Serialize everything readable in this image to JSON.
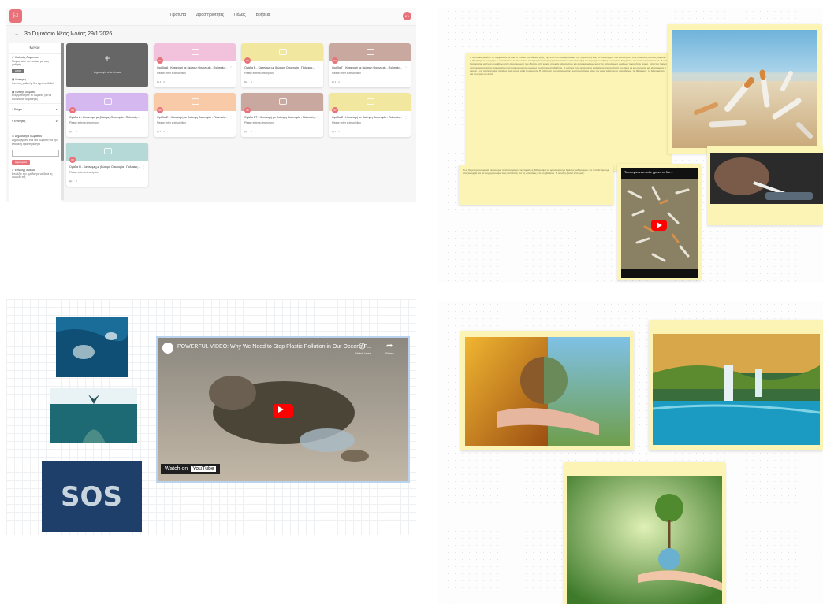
{
  "app": {
    "logo_glyph": "⚐",
    "nav": [
      "Πρότυπα",
      "Δραστηριότητες",
      "Πόλεις",
      "Βοήθεια"
    ],
    "user_initials": "ΚΑ",
    "back_glyph": "←",
    "page_title": "3ο Γυμνάσιο Νέας Ιωνίας 29/1/2026",
    "sidebar": {
      "title": "Μενού",
      "sec1_head": "✔ Κωδικός δωματίου",
      "sec1_text": "Μοιραστείτε τον κωδικό με τους μαθητές",
      "room_code": "ARN8",
      "sec2_head": "▤ Μαθητές",
      "sec2_text": "Κανένας μαθητής δεν έχει συνδεθεί",
      "sec3_head": "▤ Ενεργή δωμάτια",
      "sec3_text": "Ενεργοποιήστε το δωμάτιο για να συνδεθούν οι μαθητές",
      "row1": "≡ Στόχοι",
      "row2": "≡ Ενότητες",
      "chevron": "∨",
      "sec4_head": "☐ Δημιουργία δωματίου",
      "sec4_text": "Δημιουργήστε ένα νέο δωμάτιο για την επόμενη δραστηριότητα",
      "create_btn": "Δημιουργία",
      "sec5_head": "✔ Επιλογή ομάδας",
      "sec5_text": "Επιλέξτε την ομάδα για να δείτε τη δουλειά της"
    },
    "add_card_label": "Δημιουργία νέου πίνακα",
    "add_glyph": "+",
    "cards": [
      {
        "num": "01",
        "title": "Ομάδα Α - Κατανομή με βιώσιμη Οικονομία - Πολιτικές...",
        "desc": "Please enter a description",
        "foot": "▤ 4 · 4",
        "color": "#f2c2dd"
      },
      {
        "num": "02",
        "title": "Ομάδα Β - Κατανομή με βιώσιμη Οικονομία - Πολιτικές...",
        "desc": "Please enter a description",
        "foot": "▤ 4 · 4",
        "color": "#f2e79e"
      },
      {
        "num": "03",
        "title": "Ομάδα Γ - Κατανομή με βιώσιμη Οικονομία - Πολιτικές...",
        "desc": "Please enter a description",
        "foot": "▤ 4 · 4",
        "color": "#c9a99f"
      },
      {
        "num": "04",
        "title": "Ομάδα Δ - Κατανομή με βιώσιμη Οικονομία - Πολιτικές...",
        "desc": "Please enter a description",
        "foot": "▤ 4 · 4",
        "color": "#d6b8f0"
      },
      {
        "num": "05",
        "title": "Ομάδα Ε - Κατανομή με βιώσιμη Οικονομία - Πολιτικές...",
        "desc": "Please enter a description",
        "foot": "▤ 3 · 4",
        "color": "#f9caa8"
      },
      {
        "num": "06",
        "title": "Ομάδα ΣΤ - Κατανομή με βιώσιμη Οικονομία - Πολιτικές...",
        "desc": "Please enter a description",
        "foot": "▤ 4 · 4",
        "color": "#c9a99f"
      },
      {
        "num": "07",
        "title": "Ομάδα Ζ - Κατανομή με βιώσιμη Οικονομία - Πολιτικές...",
        "desc": "Please enter a description",
        "foot": "▤ 1 · 4",
        "color": "#f2e79e"
      },
      {
        "num": "08",
        "title": "Ομάδα Η - Κατανομή με βιώσιμη Οικονομία - Πολιτικές...",
        "desc": "Please enter a description",
        "foot": "▤ 3 · 4",
        "color": "#b5d9d6"
      }
    ],
    "colors": {
      "accent": "#e8727a",
      "add_card": "#666666",
      "note": "#fbf4b4"
    }
  },
  "board_smoking": {
    "note_text": "Η ταμπακιά μολύνει το περιβάλλον σε όλα τα στάδια του κύκλου ζωής της, από την καλλιέργεια και την παραγωγή έως τα αποτσίγαρα που καταλήγουν στις θάλασσες και στις παραλίες. Τα φίλτρα των τσιγάρων αποτελούν ένα από τα πιο συνηθισμένα απορρίμματα πλαστικού στον πλανήτη και περιέχουν τοξικές ουσίες που διαρρέουν στο έδαφος και στο νερό. Η καλλιέργεια του καπνού συμβάλλει στην απογύμνωση των δασών, στη χρήση χημικών λιπασμάτων και φυτοφαρμάκων και στην κατανάλωση μεγάλων ποσοτήτων νερού. Κατά την παραγωγή εκλύονται αέρια θερμοκηπίου και δημιουργούνται μεγάλες ποσότητες αποβλήτων. Ο καπνός που εκπέμπεται επιβαρύνει την ποιότητα του αέρα σε εσωτερικούς και εξωτερικούς χώρους, ενώ τα πεταγμένα τσιγάρα είναι συχνή αιτία πυρκαγιών. Η ελάττωση του καπνίσματος δεν προστατεύει μόνο την υγεία αλλά και το περιβάλλον, τις θάλασσες, τα δάση και τα ζώα που ζουν σε αυτά.",
    "note2_text": "Πώς θα μπορούσαμε να μειώσουμε τα αποτσίγαρα στις παραλίες; Μπορούμε να οργανώσουμε δράσεις καθαρισμού, να τοποθετήσουμε σταχτοδοχεία και να ενημερώσουμε τους καπνιστές για τις συνέπειες στο περιβάλλον. Η αλλαγή ξεκινά από εμάς.",
    "video_title": "Τι απογίνονται καθε χρόνο τα δισ..."
  },
  "board_plastic": {
    "video_title": "POWERFUL VIDEO: Why We Need to Stop Plastic Pollution in Our Oceans F...",
    "watch_later": "Watch later",
    "share": "Share",
    "watch_on": "Watch on",
    "youtube": "YouTube",
    "sos_text": "SOS"
  }
}
